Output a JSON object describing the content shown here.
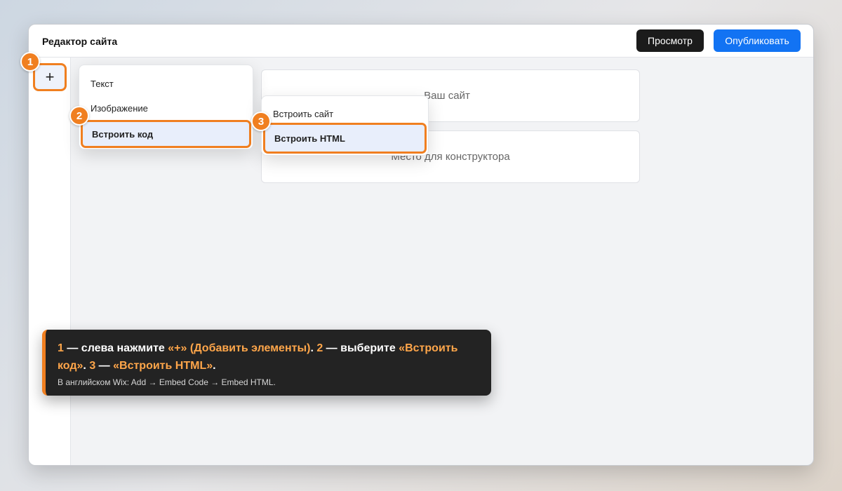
{
  "header": {
    "title": "Редактор сайта",
    "preview_label": "Просмотр",
    "publish_label": "Опубликовать"
  },
  "sidebar": {
    "add_label": "+"
  },
  "badges": {
    "one": "1",
    "two": "2",
    "three": "3"
  },
  "canvas": {
    "card1": "Ваш сайт",
    "card2": "Место для конструктора"
  },
  "add_menu": {
    "items": [
      "Текст",
      "Изображение",
      "Встроить код"
    ],
    "active": "Встроить код"
  },
  "embed_submenu": {
    "items": [
      "Встроить сайт",
      "Встроить HTML"
    ],
    "active": "Встроить HTML"
  },
  "tooltip": {
    "n1": "1",
    "t1": " — слева нажмите ",
    "h1": "«+» (Добавить элементы)",
    "t2": ". ",
    "n2": "2",
    "t3": " — выберите ",
    "h2": "«Встроить код»",
    "t4": ". ",
    "n3": "3",
    "t5": " — ",
    "h3": "«Встроить HTML»",
    "t6": ".",
    "sub": "В английском Wix: Add → Embed Code → Embed HTML."
  },
  "colors": {
    "accent": "#f07f20",
    "publish": "#1273f3",
    "preview": "#1b1b1b",
    "highlight_text": "#ffa64a"
  }
}
